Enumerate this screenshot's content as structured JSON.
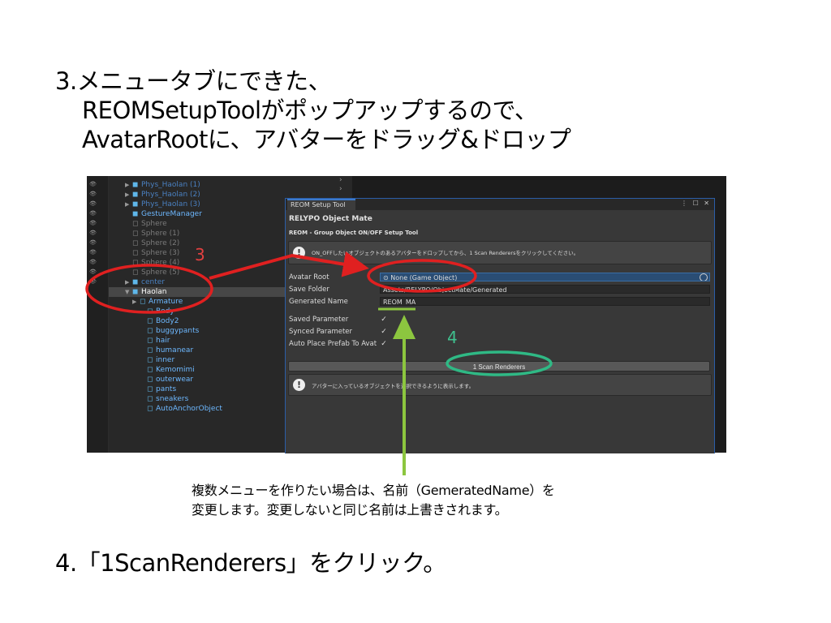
{
  "instructions": {
    "step3_line1": "3.メニュータブにできた、",
    "step3_line2": "REOMSetupToolがポップアップするので、",
    "step3_line3": "AvatarRootに、アバターをドラッグ&ドロップ",
    "step4": "4.「1ScanRenderers」をクリック。",
    "note_line1": "複数メニューを作りたい場合は、名前（GemeratedName）を",
    "note_line2": "変更します。変更しないと同じ名前は上書きされます。"
  },
  "annotations": {
    "number_3": "3",
    "number_4": "4",
    "red": "#e02020",
    "teal": "#2fb985",
    "green": "#8cc63f"
  },
  "hierarchy": {
    "items": [
      {
        "label": "Phys_Haolan (1)",
        "color": "#4a80c0",
        "arrow": "▶",
        "icon": "cube-icon"
      },
      {
        "label": "Phys_Haolan (2)",
        "color": "#4a80c0",
        "arrow": "▶",
        "icon": "cube-icon"
      },
      {
        "label": "Phys_Haolan (3)",
        "color": "#4a80c0",
        "arrow": "▶",
        "icon": "cube-icon"
      },
      {
        "label": "GestureManager",
        "color": "#6db8ff",
        "arrow": "",
        "icon": "cube-icon"
      },
      {
        "label": "Sphere",
        "color": "#7a7a7a",
        "arrow": "",
        "icon": "cube-outline-icon"
      },
      {
        "label": "Sphere (1)",
        "color": "#7a7a7a",
        "arrow": "",
        "icon": "cube-outline-icon"
      },
      {
        "label": "Sphere (2)",
        "color": "#7a7a7a",
        "arrow": "",
        "icon": "cube-outline-icon"
      },
      {
        "label": "Sphere (3)",
        "color": "#7a7a7a",
        "arrow": "",
        "icon": "cube-outline-icon"
      },
      {
        "label": "Sphere (4)",
        "color": "#7a7a7a",
        "arrow": "",
        "icon": "cube-outline-icon"
      },
      {
        "label": "Sphere (5)",
        "color": "#7a7a7a",
        "arrow": "",
        "icon": "cube-outline-icon"
      },
      {
        "label": "center",
        "color": "#4a80c0",
        "arrow": "▶",
        "icon": "cube-icon"
      },
      {
        "label": "Haolan",
        "color": "#ffffff",
        "arrow": "▼",
        "icon": "cube-icon"
      },
      {
        "label": "Armature",
        "color": "#6db8ff",
        "arrow": "▶",
        "icon": "cube-outline-icon"
      },
      {
        "label": "Body",
        "color": "#6db8ff",
        "arrow": "",
        "icon": "cube-outline-icon"
      },
      {
        "label": "Body2",
        "color": "#6db8ff",
        "arrow": "",
        "icon": "cube-outline-icon"
      },
      {
        "label": "buggypants",
        "color": "#6db8ff",
        "arrow": "",
        "icon": "cube-outline-icon"
      },
      {
        "label": "hair",
        "color": "#6db8ff",
        "arrow": "",
        "icon": "cube-outline-icon"
      },
      {
        "label": "humanear",
        "color": "#6db8ff",
        "arrow": "",
        "icon": "cube-outline-icon"
      },
      {
        "label": "inner",
        "color": "#6db8ff",
        "arrow": "",
        "icon": "cube-outline-icon"
      },
      {
        "label": "Kemomimi",
        "color": "#6db8ff",
        "arrow": "",
        "icon": "cube-outline-icon"
      },
      {
        "label": "outerwear",
        "color": "#6db8ff",
        "arrow": "",
        "icon": "cube-outline-icon"
      },
      {
        "label": "pants",
        "color": "#6db8ff",
        "arrow": "",
        "icon": "cube-outline-icon"
      },
      {
        "label": "sneakers",
        "color": "#6db8ff",
        "arrow": "",
        "icon": "cube-outline-icon"
      },
      {
        "label": "AutoAnchorObject",
        "color": "#6db8ff",
        "arrow": "",
        "icon": "cube-outline-icon"
      }
    ]
  },
  "setup_window": {
    "tab_title": "REOM Setup Tool",
    "window_controls": "⋮ ☐ ✕",
    "product_title": "RELYPO Object Mate",
    "subtitle": "REOM - Group Object ON/OFF Setup Tool",
    "info_text": "ON_OFFしたいオブジェクトのあるアバターをドロップしてから、1 Scan Renderersをクリックしてください。",
    "avatar_root_label": "Avatar Root",
    "avatar_root_value": "⊙ None (Game Object)",
    "save_folder_label": "Save Folder",
    "save_folder_value": "Assets/RELYPO/ObjectMate/Generated",
    "generated_name_label": "Generated Name",
    "generated_name_value": "REOM_MA",
    "saved_parameter_label": "Saved Parameter",
    "synced_parameter_label": "Synced Parameter",
    "auto_place_label": "Auto Place Prefab To Avat",
    "checkmark": "✓",
    "scan_button": "1 Scan Renderers",
    "info2_text": "アバターに入っているオブジェクトを選択できるように表示します。",
    "info_icon_glyph": "!"
  }
}
